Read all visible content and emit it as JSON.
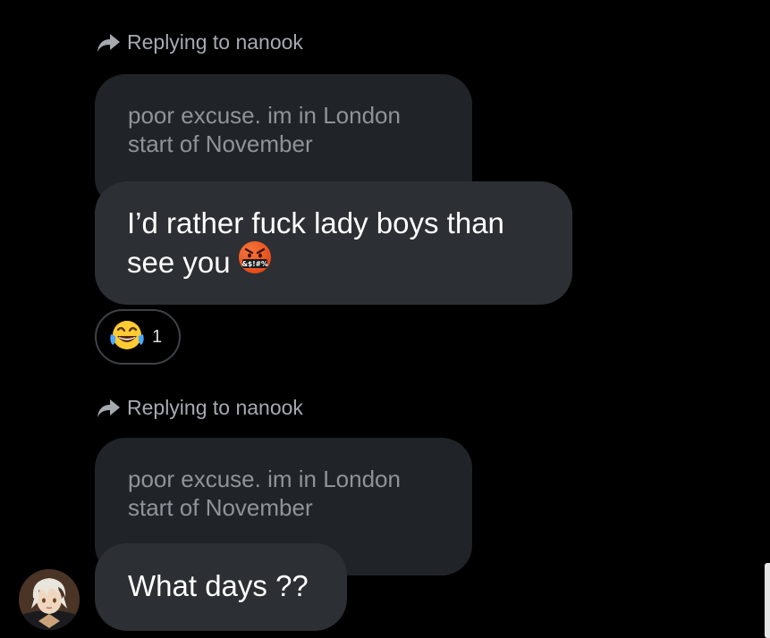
{
  "threads": [
    {
      "reply_label": "Replying to nanook",
      "quoted_lines": [
        "poor excuse. im in London",
        "start of  November"
      ],
      "message_lines": [
        "I’d rather fuck lady boys than",
        "see you"
      ],
      "message_emoji": "cursing-face-emoji",
      "reaction": {
        "emoji": "tears-of-joy-emoji",
        "count": "1"
      }
    },
    {
      "reply_label": "Replying to nanook",
      "quoted_lines": [
        "poor excuse. im in London",
        "start of  November"
      ],
      "message_lines": [
        "What days ??"
      ]
    }
  ],
  "icons": {
    "reply": "reply-arrow-icon",
    "avatar": "user-avatar"
  },
  "colors": {
    "background": "#000000",
    "quote_bubble": "#202327",
    "message_bubble": "#2c2f33",
    "secondary_text": "#a6aab0"
  }
}
